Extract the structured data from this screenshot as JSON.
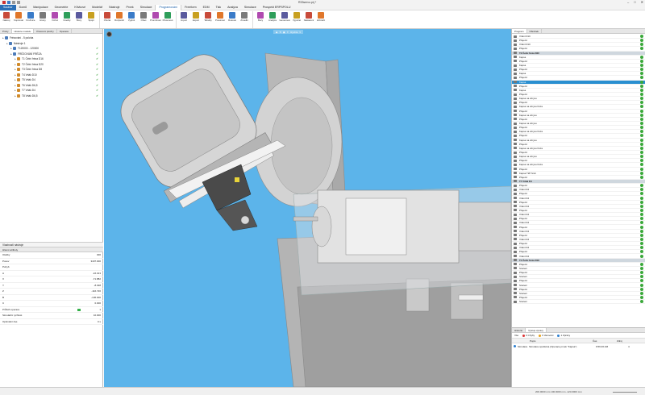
{
  "app": {
    "title": "R33servo.prj *"
  },
  "menu": [
    "Soubor",
    "Domů",
    "Manipulace",
    "Geometrie",
    "Křivkové",
    "Modelář",
    "Nástroje",
    "Prvek",
    "Simulace",
    "Programování",
    "Freeform",
    "EDM",
    "Tisk",
    "Analýza",
    "Simulace",
    "Prospekt ERPSPOLU"
  ],
  "ribbon": [
    "Nástroj",
    "Kopírovat",
    "Kružnice",
    "Hrany",
    "Vrchol",
    "Úsečky",
    "Boxy",
    "Spojit",
    "Ořezat",
    "Rozpustit",
    "Vyplnit",
    "Ofset",
    "Promítnout",
    "Přesunout",
    "Import",
    "Export",
    "Tabulky",
    "Posunout",
    "Rotovat",
    "Zrcadlit",
    "Řezy",
    "Analýza",
    "Generovat",
    "Výpočet",
    "Nastavení",
    "Zobrazit"
  ],
  "left": {
    "tabs": [
      "Prvky",
      "Historie modelu",
      "Pracovní plochy",
      "Operace"
    ],
    "tree": [
      {
        "label": "Frézování - 5 poloha",
        "lvl": 0
      },
      {
        "label": "Nástroje 1",
        "lvl": 1
      },
      {
        "label": "T120000 - 120000",
        "lvl": 2
      },
      {
        "label": "FRÉZOVÁNÍ FRÉZA",
        "lvl": 2
      },
      {
        "label": "T1 Čelní fréza D16",
        "lvl": 3
      },
      {
        "label": "T2 Čelní fréza D20",
        "lvl": 3
      },
      {
        "label": "T3 Čelní fréza D8",
        "lvl": 3
      },
      {
        "label": "T4 Vrták D10",
        "lvl": 3
      },
      {
        "label": "T5 Vrták D4",
        "lvl": 3
      },
      {
        "label": "T6 Vrták D6,5",
        "lvl": 3
      },
      {
        "label": "T7 Vrták D4",
        "lvl": 3
      },
      {
        "label": "T8 Vrták D6,5",
        "lvl": 3
      }
    ],
    "props_title": "Vlastnosti nástroje",
    "props_sub": "Hlavní atributy",
    "props": [
      {
        "k": "Otáčky",
        "v": "300"
      },
      {
        "k": "Posuv",
        "v": "3407.000"
      },
      {
        "k": "Pohyb",
        "v": ""
      },
      {
        "k": "A",
        "v": "-16.013"
      },
      {
        "k": "X",
        "v": "-71.882"
      },
      {
        "k": "Y",
        "v": "-8.038"
      },
      {
        "k": "Z",
        "v": "-116.726"
      },
      {
        "k": "B",
        "v": "-136.000"
      },
      {
        "k": "C",
        "v": "0.000"
      },
      {
        "k": "Průběh operace",
        "v": "1"
      },
      {
        "k": "Simulační rychlost",
        "v": "10.000"
      },
      {
        "k": "Optimální čas",
        "v": "0 s"
      }
    ]
  },
  "viewport": {
    "toolbar": [
      "◆",
      "⟲",
      "▣",
      "✦",
      "Rychlé",
      "▾"
    ]
  },
  "right": {
    "tabs": [
      "Program",
      "Obrobek"
    ],
    "ops": [
      {
        "t": "Vrtání D10",
        "g": 0
      },
      {
        "t": "Přejezd",
        "g": 0
      },
      {
        "t": "Vrtání D10",
        "g": 0
      },
      {
        "t": "Přejezd",
        "g": 0
      },
      {
        "t": "T2 Čelní fréza D20",
        "g": 1
      },
      {
        "t": "Kapsa",
        "g": 0
      },
      {
        "t": "Přejezd",
        "g": 0
      },
      {
        "t": "Kapsa",
        "g": 0
      },
      {
        "t": "Přejezd",
        "g": 0
      },
      {
        "t": "Kapsa",
        "g": 0
      },
      {
        "t": "Přejezd",
        "g": 0
      },
      {
        "t": "Kapsa",
        "g": 2
      },
      {
        "t": "Přejezd",
        "g": 0
      },
      {
        "t": "Kapsa",
        "g": 0
      },
      {
        "t": "Přejezd",
        "g": 0
      },
      {
        "t": "Kapsa na obrysu",
        "g": 0
      },
      {
        "t": "Přejezd",
        "g": 0
      },
      {
        "t": "Kapsa na obrysu fréza",
        "g": 0
      },
      {
        "t": "Přejezd",
        "g": 0
      },
      {
        "t": "Kapsa na obrysu",
        "g": 0
      },
      {
        "t": "Přejezd",
        "g": 0
      },
      {
        "t": "Kapsa na obrysu",
        "g": 0
      },
      {
        "t": "Přejezd",
        "g": 0
      },
      {
        "t": "Kapsa na obrysu fréza",
        "g": 0
      },
      {
        "t": "Přejezd",
        "g": 0
      },
      {
        "t": "Kapsa na obrysu",
        "g": 0
      },
      {
        "t": "Přejezd",
        "g": 0
      },
      {
        "t": "Kapsa na obrysu fréza",
        "g": 0
      },
      {
        "t": "Přejezd",
        "g": 0
      },
      {
        "t": "Kapsa na obrysu",
        "g": 0
      },
      {
        "t": "Přejezd",
        "g": 0
      },
      {
        "t": "Kapsa na obrysu fréza",
        "g": 0
      },
      {
        "t": "Přejezd",
        "g": 0
      },
      {
        "t": "Kapsa T2P hrub",
        "g": 0
      },
      {
        "t": "Přejezd",
        "g": 0
      },
      {
        "t": "T7 Vrták D4",
        "g": 1
      },
      {
        "t": "Přejezd",
        "g": 0
      },
      {
        "t": "Vrtání D4",
        "g": 0
      },
      {
        "t": "Přejezd",
        "g": 0
      },
      {
        "t": "Vrtání D4",
        "g": 0
      },
      {
        "t": "Přejezd",
        "g": 0
      },
      {
        "t": "Vrtání D4",
        "g": 0
      },
      {
        "t": "Přejezd",
        "g": 0
      },
      {
        "t": "Vrtání D4",
        "g": 0
      },
      {
        "t": "Přejezd",
        "g": 0
      },
      {
        "t": "Vrtání D4",
        "g": 0
      },
      {
        "t": "Přejezd",
        "g": 0
      },
      {
        "t": "Vrtání D4",
        "g": 0
      },
      {
        "t": "Přejezd",
        "g": 0
      },
      {
        "t": "Vrtání D4",
        "g": 0
      },
      {
        "t": "Přejezd",
        "g": 0
      },
      {
        "t": "Vrtání D4",
        "g": 0
      },
      {
        "t": "Přejezd",
        "g": 0
      },
      {
        "t": "Vrtání D4",
        "g": 0
      },
      {
        "t": "T1 Čelní fréza D16",
        "g": 1
      },
      {
        "t": "Přejezd",
        "g": 0
      },
      {
        "t": "Srazení",
        "g": 0
      },
      {
        "t": "Přejezd",
        "g": 0
      },
      {
        "t": "Srazení",
        "g": 0
      },
      {
        "t": "Přejezd",
        "g": 0
      },
      {
        "t": "Srazení",
        "g": 0
      },
      {
        "t": "Přejezd",
        "g": 0
      },
      {
        "t": "Srazení",
        "g": 0
      },
      {
        "t": "Přejezd",
        "g": 0
      },
      {
        "t": "Srazení",
        "g": 0
      }
    ],
    "msg_tabs": [
      "Historie",
      "Výstup zprávy"
    ],
    "msg_toolbar": {
      "all": "Vše",
      "errors": "0 Chyby",
      "warnings": "0 Varování",
      "info": "1 Zprávy"
    },
    "msg_cols": {
      "n": "Popis",
      "time": "Čas",
      "src": "Zdroj"
    },
    "msg_row": {
      "type": "Simulace",
      "text": "Simulace spuštěna (Operace prvek \"Kapsa\")",
      "time": "9:59:26 AM",
      "num": "4"
    }
  },
  "status": {
    "text": "200.0000 mm  100.0000 mm  -120.0000 mm"
  }
}
